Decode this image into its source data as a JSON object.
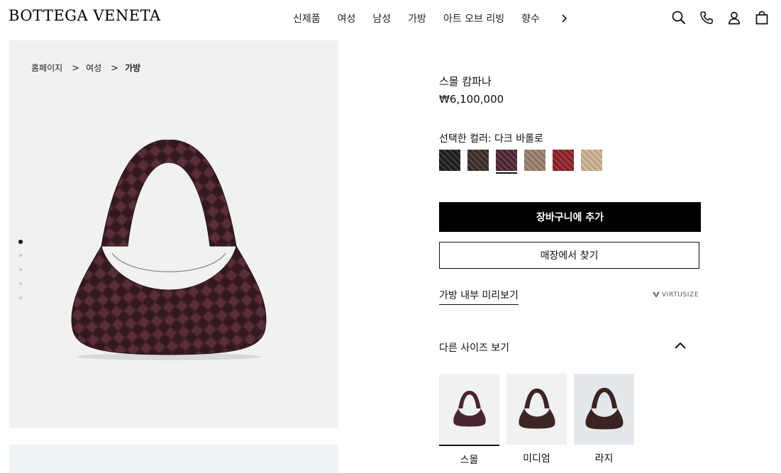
{
  "brand": {
    "logo": "BOTTEGA VENETA"
  },
  "nav": {
    "items": [
      "신제품",
      "여성",
      "남성",
      "가방",
      "아트 오브 리빙",
      "향수"
    ],
    "more_icon": "chevron-right-icon"
  },
  "header_icons": [
    "search-icon",
    "phone-icon",
    "account-icon",
    "shopping-bag-icon"
  ],
  "breadcrumb": {
    "items": [
      "홈페이지",
      "여성",
      "가방"
    ],
    "separator": ">"
  },
  "gallery": {
    "total_images": 5,
    "active_index": 0,
    "main_image": "woven-leather-hobo-bag"
  },
  "product": {
    "name": "스몰 캄파나",
    "price": "₩6,100,000",
    "color_label": "선택한 컬러: 다크 바롤로",
    "swatches": [
      {
        "name": "black",
        "color": "#1a1a1a"
      },
      {
        "name": "dark-brown",
        "color": "#3a2a26"
      },
      {
        "name": "dark-barolo",
        "color": "#4b2330",
        "selected": true
      },
      {
        "name": "taupe",
        "color": "#9a7f6c"
      },
      {
        "name": "red",
        "color": "#8d1f24"
      },
      {
        "name": "beige",
        "color": "#cdb38f"
      }
    ]
  },
  "actions": {
    "add_to_cart": "장바구니에 추가",
    "find_in_store": "매장에서 찾기",
    "inside_preview": "가방 내부 미리보기",
    "virtusize": "VIRTUSIZE"
  },
  "sizes": {
    "heading": "다른 사이즈 보기",
    "options": [
      {
        "label": "스몰",
        "selected": true
      },
      {
        "label": "미디엄"
      },
      {
        "label": "라지"
      }
    ]
  },
  "colors": {
    "bag": "#3f1f26",
    "gallery_bg": "#f0f1f1"
  }
}
